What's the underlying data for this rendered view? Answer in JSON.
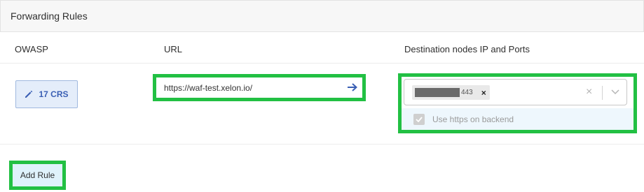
{
  "panel": {
    "title": "Forwarding Rules"
  },
  "columns": {
    "owasp": "OWASP",
    "url": "URL",
    "destination": "Destination nodes IP and Ports"
  },
  "rule": {
    "crs_button_label": "17 CRS",
    "crs_icon": "pencil-icon",
    "url_value": "https://waf-test.xelon.io/",
    "url_action_icon": "arrow-right-icon",
    "destination_chip_port": "443",
    "destination_chip_remove": "×",
    "destination_clear": "×",
    "use_https_label": "Use https on backend",
    "use_https_checked": true
  },
  "actions": {
    "add_rule_label": "Add Rule"
  },
  "colors": {
    "highlight": "#22c043",
    "accent": "#3a5fb4"
  }
}
